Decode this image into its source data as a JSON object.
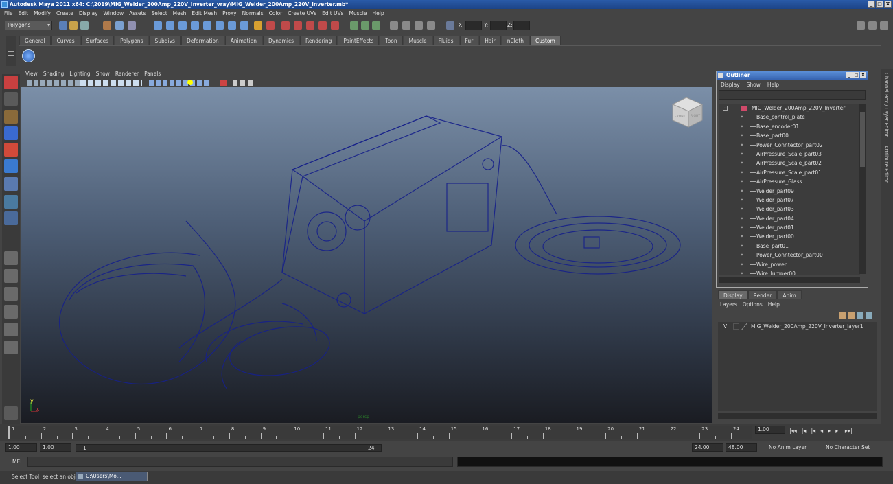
{
  "window": {
    "title": "Autodesk Maya 2011 x64: C:\\2019\\MIG_Welder_200Amp_220V_Inverter_vray\\MIG_Welder_200Amp_220V_Inverter.mb*",
    "minimize": "_",
    "maximize": "□",
    "close": "X"
  },
  "menubar": [
    "File",
    "Edit",
    "Modify",
    "Create",
    "Display",
    "Window",
    "Assets",
    "Select",
    "Mesh",
    "Edit Mesh",
    "Proxy",
    "Normals",
    "Color",
    "Create UVs",
    "Edit UVs",
    "Muscle",
    "Help"
  ],
  "statusline": {
    "mode": "Polygons",
    "x_label": "X:",
    "y_label": "Y:",
    "z_label": "Z:"
  },
  "shelf": {
    "tabs": [
      "General",
      "Curves",
      "Surfaces",
      "Polygons",
      "Subdivs",
      "Deformation",
      "Animation",
      "Dynamics",
      "Rendering",
      "PaintEffects",
      "Toon",
      "Muscle",
      "Fluids",
      "Fur",
      "Hair",
      "nCloth",
      "Custom"
    ],
    "active_tab": "Custom"
  },
  "viewport": {
    "menus": [
      "View",
      "Shading",
      "Lighting",
      "Show",
      "Renderer",
      "Panels"
    ],
    "camera_label": "persp",
    "viewcube": {
      "front": "FRONT",
      "right": "RIGHT"
    },
    "axis": {
      "y": "y",
      "x": "x"
    },
    "wire_color": "#16208a"
  },
  "outliner": {
    "title": "Outliner",
    "menus": [
      "Display",
      "Show",
      "Help"
    ],
    "root": "MIG_Welder_200Amp_220V_Inverter",
    "items": [
      "Base_control_plate",
      "Base_encoder01",
      "Base_part00",
      "Power_Conntector_part02",
      "AirPressure_Scale_part03",
      "AirPressure_Scale_part02",
      "AirPressure_Scale_part01",
      "AirPressure_Glass",
      "Welder_part09",
      "Welder_part07",
      "Welder_part03",
      "Welder_part04",
      "Welder_part01",
      "Welder_part00",
      "Base_part01",
      "Power_Conntector_part00",
      "Wire_power",
      "Wire_Jumper00"
    ]
  },
  "layer_editor": {
    "tabs": [
      "Display",
      "Render",
      "Anim"
    ],
    "active_tab": "Display",
    "menus": [
      "Layers",
      "Options",
      "Help"
    ],
    "layer": {
      "visible": "V",
      "name": "MIG_Welder_200Amp_220V_Inverter_layer1"
    }
  },
  "right_strip": {
    "channel_box": "Channel Box / Layer Editor",
    "attribute_editor": "Attribute Editor"
  },
  "timeline": {
    "ticks": [
      "1",
      "2",
      "3",
      "4",
      "5",
      "6",
      "7",
      "8",
      "9",
      "10",
      "11",
      "12",
      "13",
      "14",
      "15",
      "16",
      "17",
      "18",
      "19",
      "20",
      "21",
      "22",
      "23",
      "24"
    ],
    "current_frame": "1.00"
  },
  "range": {
    "start": "1.00",
    "start_inner": "1.00",
    "slider_start": "1",
    "slider_end": "24",
    "end_inner": "24.00",
    "end": "48.00",
    "anim_layer": "No Anim Layer",
    "character_set": "No Character Set"
  },
  "command": {
    "label": "MEL"
  },
  "help": {
    "text": "Select Tool: select an object",
    "taskbar": "C:\\Users\\Mo..."
  }
}
